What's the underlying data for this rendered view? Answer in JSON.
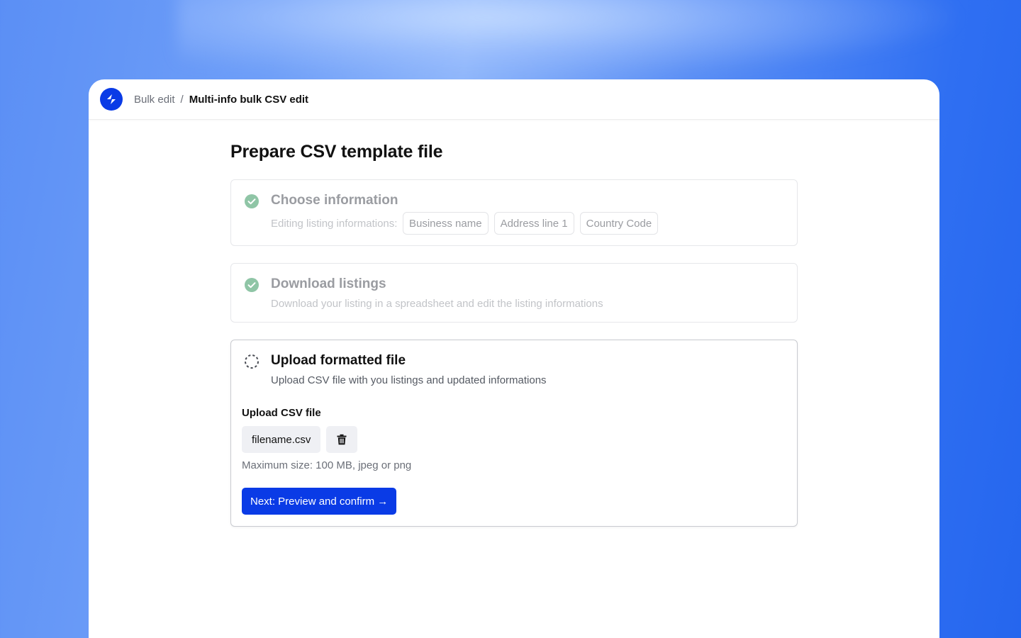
{
  "breadcrumb": {
    "parent": "Bulk edit",
    "separator": "/",
    "current": "Multi-info bulk CSV edit"
  },
  "page": {
    "title": "Prepare CSV template file"
  },
  "steps": [
    {
      "status": "done",
      "icon": "check-circle-icon",
      "title": "Choose information",
      "description": "Editing listing informations:",
      "chips": [
        "Business name",
        "Address line 1",
        "Country Code"
      ]
    },
    {
      "status": "done",
      "icon": "check-circle-icon",
      "title": "Download listings",
      "description": "Download your listing in a spreadsheet and edit the listing informations"
    },
    {
      "status": "in-progress",
      "icon": "dashed-circle-icon",
      "title": "Upload formatted file",
      "description": "Upload CSV file with you listings and updated informations",
      "upload": {
        "label": "Upload CSV file",
        "filename": "filename.csv",
        "delete_icon": "trash-icon",
        "hint": "Maximum size: 100 MB, jpeg or png",
        "next_label": "Next: Preview and confirm →"
      }
    }
  ],
  "colors": {
    "brand": "#0a3be6",
    "check": "#8fc5a6",
    "background_gradient": [
      "#5b8ff5",
      "#8fb6fb",
      "#2566ee"
    ]
  }
}
